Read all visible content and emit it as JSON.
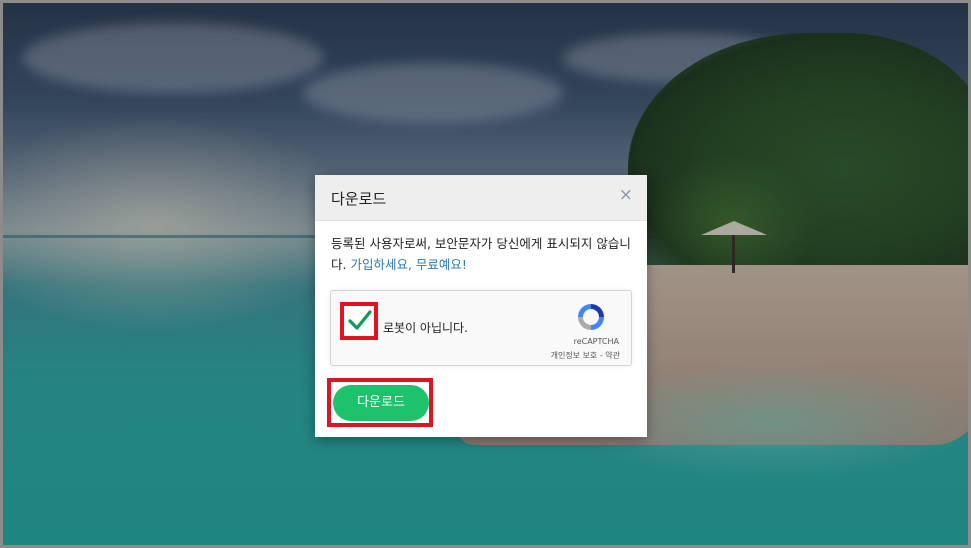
{
  "modal": {
    "title": "다운로드",
    "close_icon": "close-icon",
    "message_prefix": "등록된 사용자로써, 보안문자가 당신에게 표시되지 않습니다. ",
    "message_link": "가입하세요, 무료예요!",
    "download_label": "다운로드"
  },
  "recaptcha": {
    "label": "로봇이 아닙니다.",
    "brand": "reCAPTCHA",
    "terms": "개인정보 보호 - 약관",
    "checked": true
  },
  "colors": {
    "accent_green": "#1ec26d",
    "highlight_red": "#e0141e",
    "link_blue": "#2a7ab0"
  }
}
